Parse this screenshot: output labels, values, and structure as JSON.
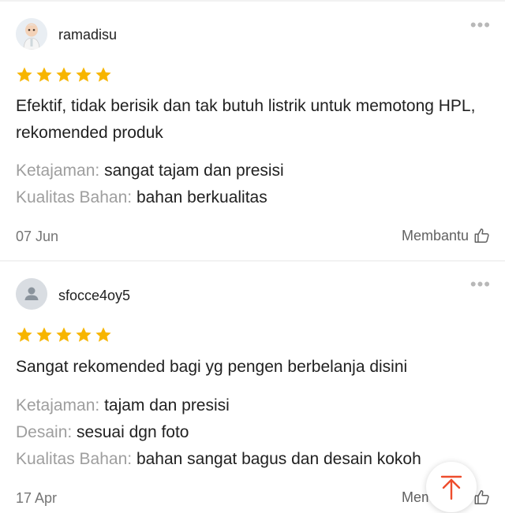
{
  "colors": {
    "star": "#f7b500",
    "scroll_top_arrow": "#ee4d2d"
  },
  "reviews": [
    {
      "username": "ramadisu",
      "rating": 5,
      "text": "Efektif, tidak berisik dan tak butuh listrik untuk memotong HPL, rekomended produk",
      "attributes": [
        {
          "label": "Ketajaman:",
          "value": "sangat tajam dan presisi"
        },
        {
          "label": "Kualitas Bahan:",
          "value": "bahan berkualitas"
        }
      ],
      "date": "07 Jun",
      "helpful_label": "Membantu"
    },
    {
      "username": "sfocce4oy5",
      "rating": 5,
      "text": "Sangat rekomended bagi yg pengen berbelanja disini",
      "attributes": [
        {
          "label": "Ketajaman:",
          "value": "tajam dan presisi"
        },
        {
          "label": "Desain:",
          "value": "sesuai dgn foto"
        },
        {
          "label": "Kualitas Bahan:",
          "value": "bahan sangat bagus dan desain kokoh"
        }
      ],
      "date": "17 Apr",
      "helpful_label": "Membantu"
    }
  ],
  "icons": {
    "more": "more-dots-icon",
    "star": "star-icon",
    "helpful": "thumbs-up-icon",
    "scroll_top": "arrow-up-icon",
    "default_avatar": "person-icon"
  }
}
